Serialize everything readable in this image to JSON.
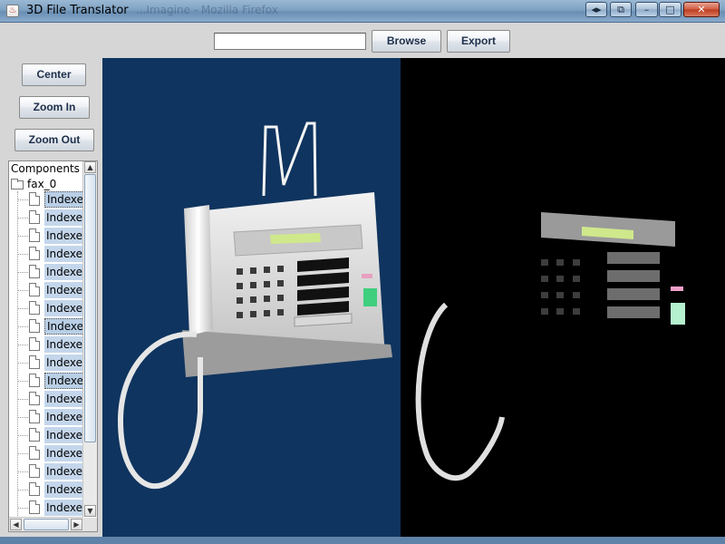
{
  "window": {
    "title": "3D File Translator",
    "title_ghost": "...Imagine - Mozilla Firefox",
    "controls": {
      "back_forward": "◂▸",
      "restore_other": "⧉",
      "minimize": "–",
      "maximize": "□",
      "close": "✕"
    }
  },
  "toolbar": {
    "path_value": "",
    "browse_label": "Browse",
    "export_label": "Export"
  },
  "sidebar": {
    "center_label": "Center",
    "zoom_in_label": "Zoom In",
    "zoom_out_label": "Zoom Out"
  },
  "tree": {
    "header": "Components",
    "root": "fax_0",
    "items": [
      {
        "label": "Indexed"
      },
      {
        "label": "Indexed"
      },
      {
        "label": "Indexed"
      },
      {
        "label": "Indexed"
      },
      {
        "label": "Indexed"
      },
      {
        "label": "Indexed"
      },
      {
        "label": "Indexed"
      },
      {
        "label": "Indexed"
      },
      {
        "label": "Indexed"
      },
      {
        "label": "Indexed"
      },
      {
        "label": "Indexed"
      },
      {
        "label": "Indexed"
      },
      {
        "label": "Indexed"
      },
      {
        "label": "Indexed"
      },
      {
        "label": "Indexed"
      },
      {
        "label": "Indexed"
      },
      {
        "label": "Indexed"
      },
      {
        "label": "Indexed"
      }
    ],
    "selected_indices": [
      0,
      7,
      10
    ]
  },
  "colors": {
    "viewport_left_bg": "#0f345f",
    "viewport_right_bg": "#000000",
    "fax_body": "#e6e6e6",
    "display_green": "#cfe88c",
    "green_button": "#3fcf7e"
  }
}
